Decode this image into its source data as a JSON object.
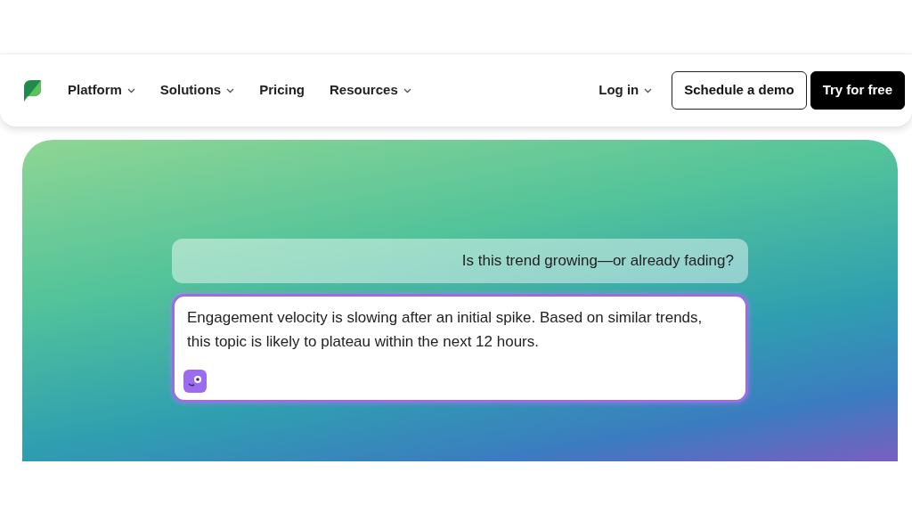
{
  "nav": {
    "items": [
      {
        "label": "Platform",
        "dropdown": true
      },
      {
        "label": "Solutions",
        "dropdown": true
      },
      {
        "label": "Pricing",
        "dropdown": false
      },
      {
        "label": "Resources",
        "dropdown": true
      }
    ],
    "login": {
      "label": "Log in",
      "dropdown": true
    },
    "buttons": [
      {
        "label": "Schedule a demo",
        "kind": "outline"
      },
      {
        "label": "Try for free",
        "kind": "solid"
      }
    ]
  },
  "chat": {
    "messages": [
      {
        "kind": "question",
        "text": "Is this trend growing—or already fading?"
      },
      {
        "kind": "answer",
        "text": "Engagement velocity is slowing after an initial spike. Based on similar trends, this topic is likely to plateau within the next 12 hours."
      }
    ]
  }
}
